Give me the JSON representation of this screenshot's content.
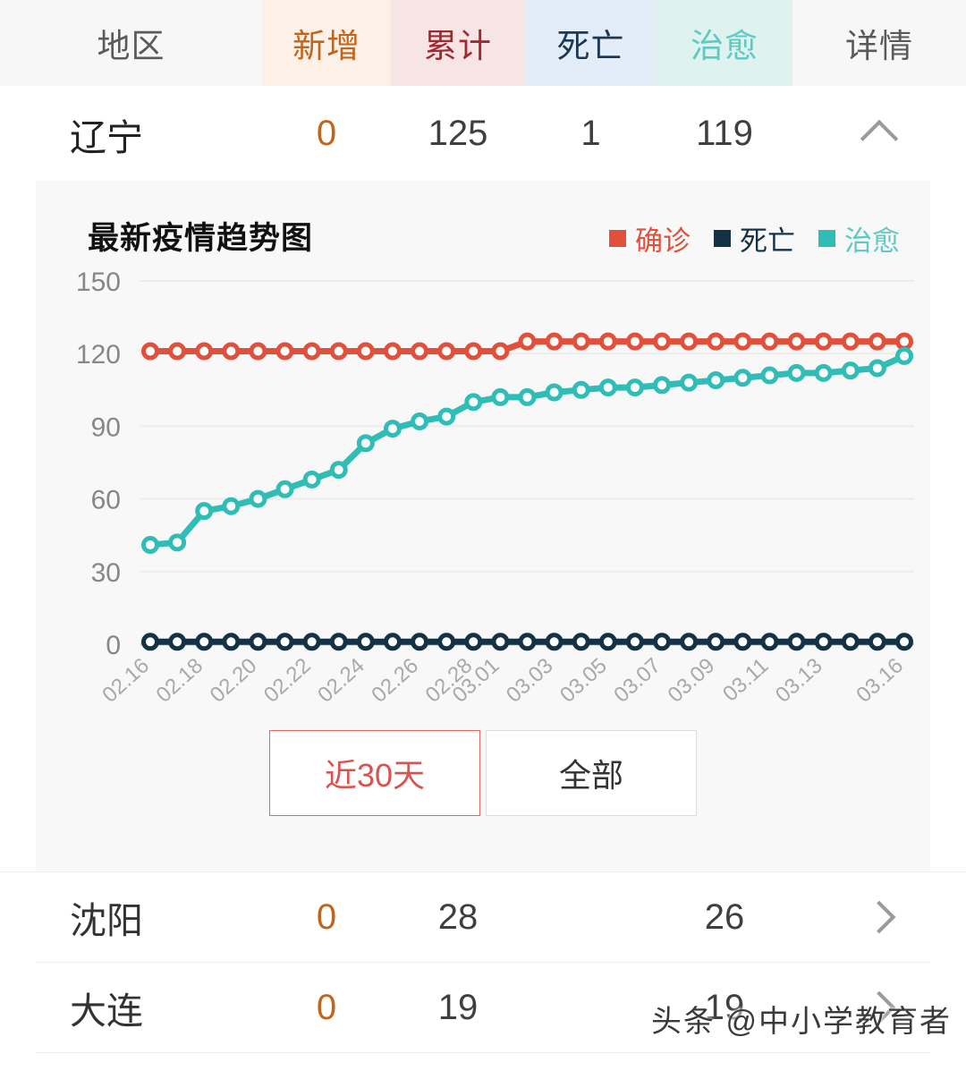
{
  "table": {
    "columns": [
      {
        "key": "region",
        "label": "地区"
      },
      {
        "key": "newly",
        "label": "新增"
      },
      {
        "key": "total",
        "label": "累计"
      },
      {
        "key": "death",
        "label": "死亡"
      },
      {
        "key": "cured",
        "label": "治愈"
      },
      {
        "key": "detail",
        "label": "详情"
      }
    ],
    "province": {
      "name": "辽宁",
      "newly": "0",
      "total": "125",
      "death": "1",
      "cured": "119",
      "toggle_icon": "chevron-up-icon"
    },
    "cities": [
      {
        "name": "沈阳",
        "newly": "0",
        "total": "28",
        "death": "",
        "cured": "26",
        "arrow_icon": "chevron-right-icon"
      },
      {
        "name": "大连",
        "newly": "0",
        "total": "19",
        "death": "",
        "cured": "19",
        "arrow_icon": "chevron-right-icon"
      }
    ]
  },
  "chart_card": {
    "title": "最新疫情趋势图",
    "legend": [
      {
        "label": "确诊",
        "color": "#e0503a"
      },
      {
        "label": "死亡",
        "color": "#143246"
      },
      {
        "label": "治愈",
        "color": "#2fbdb6"
      }
    ],
    "range_buttons": [
      {
        "label": "近30天",
        "active": true
      },
      {
        "label": "全部",
        "active": false
      }
    ]
  },
  "chart_data": {
    "type": "line",
    "title": "最新疫情趋势图",
    "xlabel": "",
    "ylabel": "",
    "ylim": [
      0,
      150
    ],
    "yticks": [
      0,
      30,
      60,
      90,
      120,
      150
    ],
    "grid": true,
    "legend_position": "top-right",
    "x": [
      "02.16",
      "02.17",
      "02.18",
      "02.19",
      "02.20",
      "02.21",
      "02.22",
      "02.23",
      "02.24",
      "02.25",
      "02.26",
      "02.27",
      "02.28",
      "03.01",
      "03.02",
      "03.03",
      "03.04",
      "03.05",
      "03.06",
      "03.07",
      "03.08",
      "03.09",
      "03.10",
      "03.11",
      "03.12",
      "03.13",
      "03.14",
      "03.15",
      "03.16"
    ],
    "xtick_labels": [
      "02.16",
      "02.18",
      "02.20",
      "02.22",
      "02.24",
      "02.26",
      "02.28",
      "03.01",
      "03.03",
      "03.05",
      "03.07",
      "03.09",
      "03.11",
      "03.13",
      "03.16"
    ],
    "series": [
      {
        "name": "确诊",
        "color": "#e0503a",
        "values": [
          121,
          121,
          121,
          121,
          121,
          121,
          121,
          121,
          121,
          121,
          121,
          121,
          121,
          121,
          125,
          125,
          125,
          125,
          125,
          125,
          125,
          125,
          125,
          125,
          125,
          125,
          125,
          125,
          125
        ]
      },
      {
        "name": "死亡",
        "color": "#143246",
        "values": [
          1,
          1,
          1,
          1,
          1,
          1,
          1,
          1,
          1,
          1,
          1,
          1,
          1,
          1,
          1,
          1,
          1,
          1,
          1,
          1,
          1,
          1,
          1,
          1,
          1,
          1,
          1,
          1,
          1
        ]
      },
      {
        "name": "治愈",
        "color": "#2fbdb6",
        "values": [
          41,
          42,
          55,
          57,
          60,
          64,
          68,
          72,
          83,
          89,
          92,
          94,
          100,
          102,
          102,
          104,
          105,
          106,
          106,
          107,
          108,
          109,
          110,
          111,
          112,
          112,
          113,
          114,
          119
        ]
      }
    ]
  },
  "watermark": "头条 @中小学教育者"
}
